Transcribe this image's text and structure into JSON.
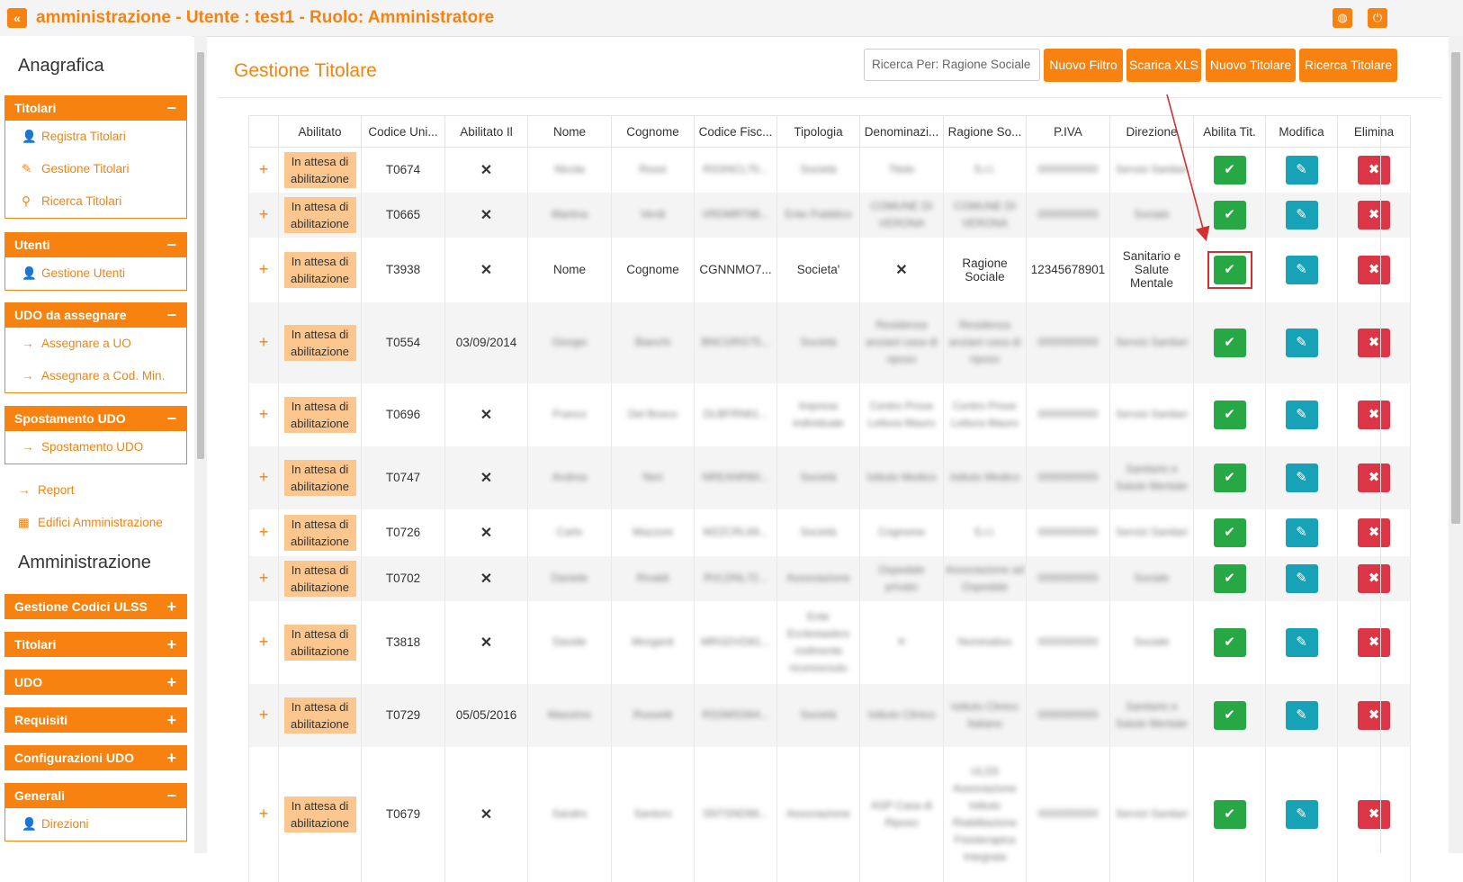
{
  "header": {
    "back_icon": "double-chevron-left-icon",
    "title": "amministrazione - Utente : test1 - Ruolo: Amministratore",
    "globe_icon": "globe-icon",
    "power_icon": "power-icon"
  },
  "sidebar": {
    "anagrafica_title": "Anagrafica",
    "groups": [
      {
        "label": "Titolari",
        "symbol": "−",
        "items": [
          {
            "label": "Registra Titolari",
            "icon": "user-add-icon"
          },
          {
            "label": "Gestione Titolari",
            "icon": "edit-icon"
          },
          {
            "label": "Ricerca Titolari",
            "icon": "search-icon"
          }
        ]
      },
      {
        "label": "Utenti",
        "symbol": "−",
        "items": [
          {
            "label": "Gestione Utenti",
            "icon": "user-add-icon"
          }
        ]
      },
      {
        "label": "UDO da assegnare",
        "symbol": "−",
        "items": [
          {
            "label": "Assegnare a UO",
            "icon": "arrow-right-icon"
          },
          {
            "label": "Assegnare a Cod. Min.",
            "icon": "arrow-right-icon"
          }
        ]
      },
      {
        "label": "Spostamento UDO",
        "symbol": "−",
        "items": [
          {
            "label": "Spostamento UDO",
            "icon": "arrow-right-icon"
          }
        ]
      }
    ],
    "plain_items": [
      {
        "label": "Report",
        "icon": "arrow-right-icon"
      },
      {
        "label": "Edifici Amministrazione",
        "icon": "building-icon"
      }
    ],
    "amministrazione_title": "Amministrazione",
    "admin_groups": [
      {
        "label": "Gestione Codici ULSS",
        "symbol": "+"
      },
      {
        "label": "Titolari",
        "symbol": "+"
      },
      {
        "label": "UDO",
        "symbol": "+"
      },
      {
        "label": "Requisiti",
        "symbol": "+"
      },
      {
        "label": "Configurazioni UDO",
        "symbol": "+"
      }
    ],
    "generali": {
      "label": "Generali",
      "symbol": "−",
      "items": [
        {
          "label": "Direzioni",
          "icon": "user-add-icon"
        }
      ]
    }
  },
  "main": {
    "page_title": "Gestione Titolare",
    "search_label": "Ricerca Per:  Ragione Sociale",
    "buttons": [
      "Nuovo Filtro",
      "Scarica XLS",
      "Nuovo Titolare",
      "Ricerca Titolare"
    ]
  },
  "table": {
    "columns": [
      "Abilitato",
      "Codice Uni...",
      "Abilitato Il",
      "Nome",
      "Cognome",
      "Codice Fisc...",
      "Tipologia",
      "Denominazi...",
      "Ragione So...",
      "P.IVA",
      "Direzione",
      "Abilita Tit.",
      "Modifica",
      "Elimina"
    ],
    "expand_symbol": "+",
    "status": "In attesa di abilitazione",
    "x_mark": "✕",
    "rows": [
      {
        "codice": "T0674",
        "data": "",
        "nome": "Nicola",
        "cognome": "Rossi",
        "cf": "RSSNCL70...",
        "tipologia": "Società",
        "denom": "Titolo",
        "ragione": "S.r.l.",
        "piva": "0000000000",
        "direzione": "Servizi Sanitari"
      },
      {
        "codice": "T0665",
        "data": "",
        "nome": "Martina",
        "cognome": "Verdi",
        "cf": "VRDMRT88...",
        "tipologia": "Ente Pubblico",
        "denom": "COMUNE DI VERONA",
        "ragione": "COMUNE DI VERONA",
        "piva": "0000000000",
        "direzione": "Sociale"
      },
      {
        "codice": "T3938",
        "data": "",
        "nome": "Nome",
        "cognome": "Cognome",
        "cf": "CGNNMO7...",
        "tipologia": "Societa'",
        "denom": "✕",
        "ragione": "Ragione Sociale",
        "piva": "12345678901",
        "direzione": "Sanitario e Salute Mentale"
      },
      {
        "codice": "T0554",
        "data": "03/09/2014",
        "nome": "Giorgio",
        "cognome": "Bianchi",
        "cf": "BNCGRG75...",
        "tipologia": "Società",
        "denom": "Residenza anziani casa di riposo",
        "ragione": "Residenza anziani casa di riposo",
        "piva": "0000000000",
        "direzione": "Servizi Sanitari"
      },
      {
        "codice": "T0696",
        "data": "",
        "nome": "Franco",
        "cognome": "Del Bosco",
        "cf": "DLBFRN61...",
        "tipologia": "Impresa individuale",
        "denom": "Centro Prove Lettura Mauro",
        "ragione": "Centro Prove Lettura Mauro",
        "piva": "0000000000",
        "direzione": "Servizi Sanitari"
      },
      {
        "codice": "T0747",
        "data": "",
        "nome": "Andrea",
        "cognome": "Neri",
        "cf": "NREANR80...",
        "tipologia": "Società",
        "denom": "Istituto Medico",
        "ragione": "Istituto Medico",
        "piva": "0000000000",
        "direzione": "Sanitario e Salute Mentale"
      },
      {
        "codice": "T0726",
        "data": "",
        "nome": "Carlo",
        "cognome": "Mazzoni",
        "cf": "MZZCRL69...",
        "tipologia": "Società",
        "denom": "Cognome",
        "ragione": "S.r.l.",
        "piva": "0000000000",
        "direzione": "Servizi Sanitari"
      },
      {
        "codice": "T0702",
        "data": "",
        "nome": "Daniele",
        "cognome": "Rivaldi",
        "cf": "RVLDNL72...",
        "tipologia": "Associazione",
        "denom": "Ospedale privato",
        "ragione": "Associazione ad Ospedale",
        "piva": "0000000000",
        "direzione": "Sociale"
      },
      {
        "codice": "T3818",
        "data": "",
        "nome": "Davide",
        "cognome": "Morganti",
        "cf": "MRGDVD81...",
        "tipologia": "Ente Ecclesiastico civilmente riconosciuto",
        "denom": "✕",
        "ragione": "Nominativo",
        "piva": "0000000000",
        "direzione": "Sociale"
      },
      {
        "codice": "T0729",
        "data": "05/05/2016",
        "nome": "Massimo",
        "cognome": "Rossetti",
        "cf": "RSSMSS64...",
        "tipologia": "Società",
        "denom": "Istituto Clinico",
        "ragione": "Istituto Clinico Italiano",
        "piva": "0000000000",
        "direzione": "Sanitario e Salute Mentale"
      },
      {
        "codice": "T0679",
        "data": "",
        "nome": "Sandro",
        "cognome": "Santoro",
        "cf": "SNTSND66...",
        "tipologia": "Associazione",
        "denom": "ASP Casa di Riposo",
        "ragione": "ULSS Associazione Istituto Riabilitazione Fisioterapica Integrata",
        "piva": "0000000000",
        "direzione": "Servizi Sanitari"
      }
    ]
  },
  "icons": {
    "check": "check-icon",
    "edit": "edit-icon",
    "delete": "close-icon"
  },
  "colors": {
    "accent": "#f7820f",
    "badge": "#fbc78e",
    "success": "#28a745",
    "info": "#17a2b8",
    "danger": "#dc3545",
    "highlight": "#d32f2f"
  }
}
